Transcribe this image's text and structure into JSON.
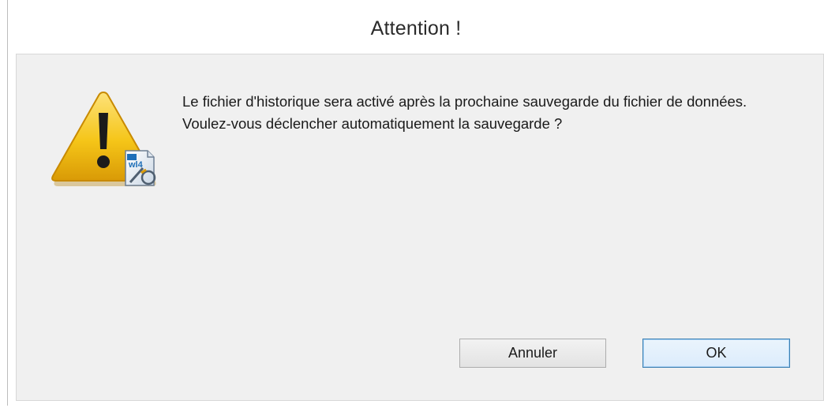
{
  "dialog": {
    "title": "Attention !",
    "message": "Le fichier d'historique sera activé après la prochaine sauvegarde du fichier de données. Voulez-vous déclencher automatiquement la sauvegarde ?",
    "icon": "warning-icon",
    "icon_badge_text": "wl4"
  },
  "buttons": {
    "cancel_label": "Annuler",
    "ok_label": "OK"
  },
  "colors": {
    "warning_yellow": "#f5c518",
    "ok_border": "#3c7fb1",
    "content_bg": "#f0f0f0"
  }
}
